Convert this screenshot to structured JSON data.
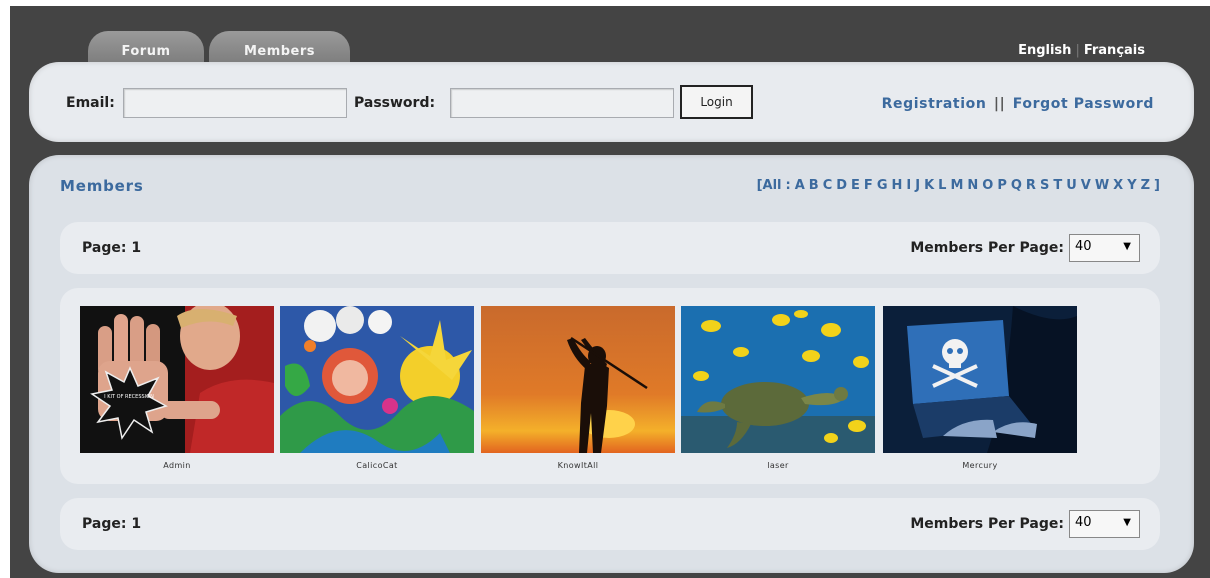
{
  "tabs": [
    {
      "label": "Forum"
    },
    {
      "label": "Members"
    }
  ],
  "languages": {
    "english": "English",
    "french": "Français",
    "separator": "|"
  },
  "login": {
    "email_label": "Email:",
    "email_value": "",
    "password_label": "Password:",
    "password_value": "",
    "login_button": "Login",
    "registration_link": "Registration",
    "separator": "||",
    "forgot_link": "Forgot Password"
  },
  "members_section": {
    "title": "Members",
    "alpha_open": "[",
    "alpha_all": "All",
    "alpha_colon": ":",
    "letters": [
      "A",
      "B",
      "C",
      "D",
      "E",
      "F",
      "G",
      "H",
      "I",
      "J",
      "K",
      "L",
      "M",
      "N",
      "O",
      "P",
      "Q",
      "R",
      "S",
      "T",
      "U",
      "V",
      "W",
      "X",
      "Y",
      "Z"
    ],
    "alpha_close": "]"
  },
  "pagination_top": {
    "page_label": "Page: 1",
    "per_page_label": "Members Per Page:",
    "per_page_value": "40"
  },
  "pagination_bottom": {
    "page_label": "Page: 1",
    "per_page_label": "Members Per Page:",
    "per_page_value": "40"
  },
  "members": [
    {
      "name": "Admin",
      "avatar_text": "I KIT OF RECESSION"
    },
    {
      "name": "CalicoCat"
    },
    {
      "name": "KnowItAll"
    },
    {
      "name": "laser"
    },
    {
      "name": "Mercury"
    }
  ],
  "colors": {
    "link_blue": "#3c6a9e",
    "frame_dark": "#444444",
    "panel_bg": "#dce1e7"
  }
}
